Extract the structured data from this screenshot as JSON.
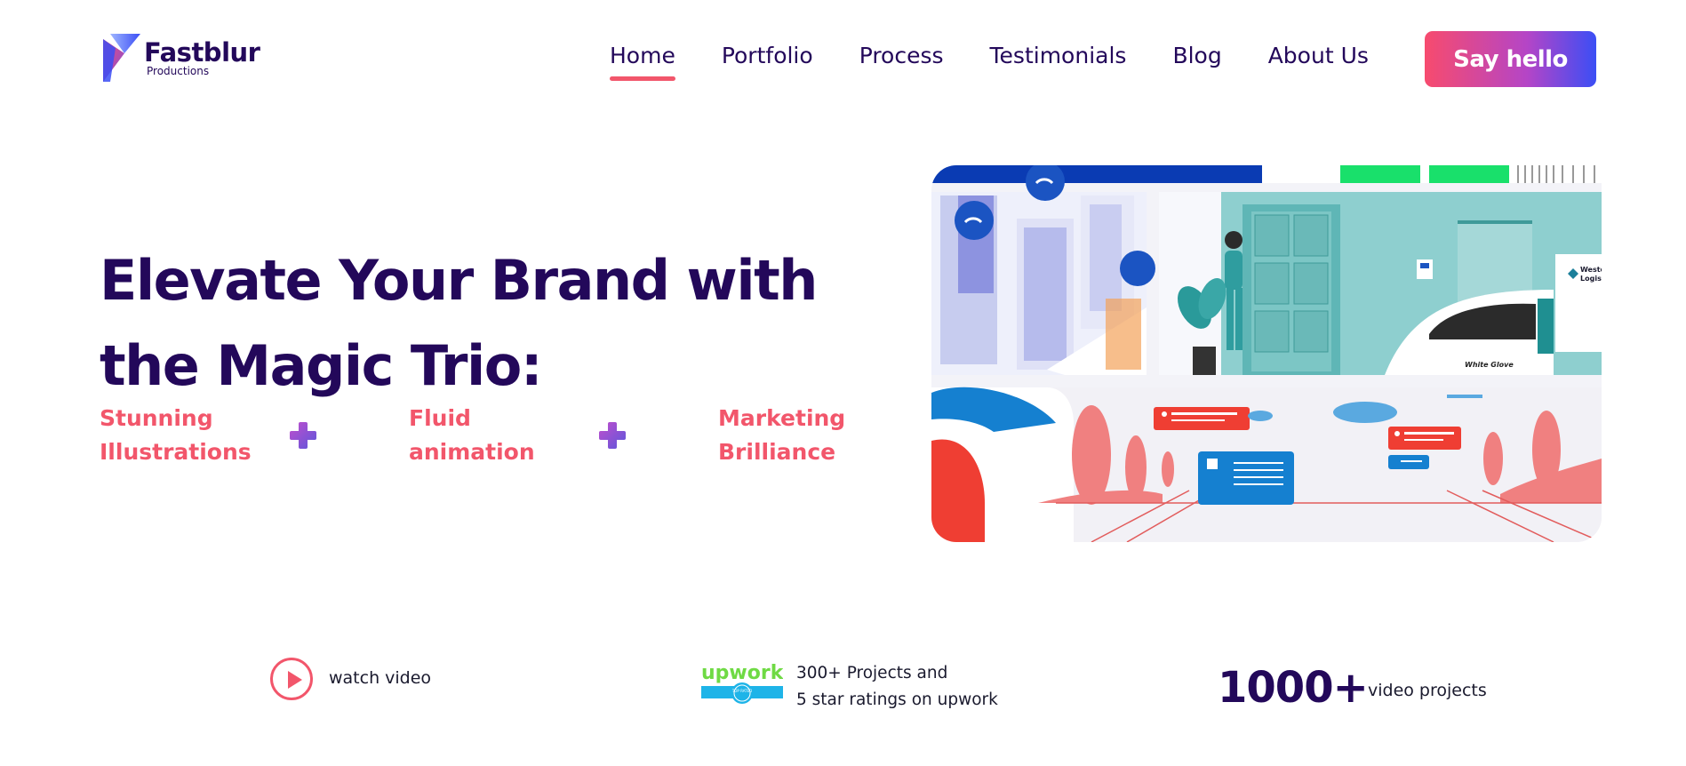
{
  "brand": {
    "name": "Fastblur",
    "sub": "Productions"
  },
  "nav": {
    "items": [
      {
        "label": "Home"
      },
      {
        "label": "Portfolio"
      },
      {
        "label": "Process"
      },
      {
        "label": "Testimonials"
      },
      {
        "label": "Blog"
      },
      {
        "label": "About Us"
      }
    ],
    "active": "Home",
    "cta": "Say hello"
  },
  "hero": {
    "title_line1": "Elevate Your Brand with",
    "title_line2": "the Magic Trio:",
    "trio": [
      {
        "line1": "Stunning",
        "line2": "Illustrations"
      },
      {
        "line1": "Fluid",
        "line2": "animation"
      },
      {
        "line1": "Marketing",
        "line2": "Brilliance"
      }
    ],
    "image_texts": {
      "sign1": "Western",
      "sign2": "Logistic",
      "van": "White Glove"
    }
  },
  "stats": {
    "watch_label": "watch video",
    "upwork_logo": "upwork",
    "upwork_badge": "TOP RATED",
    "upwork_line1": "300+ Projects and",
    "upwork_line2": "5 star ratings on upwork",
    "count": "1000+",
    "count_label": "video projects"
  },
  "colors": {
    "navy": "#23085a",
    "coral": "#f2566b",
    "purple": "#8b55d6",
    "blue": "#3b4ef5",
    "upwork_green": "#6fda44",
    "upwork_blue": "#1eb4e8"
  }
}
